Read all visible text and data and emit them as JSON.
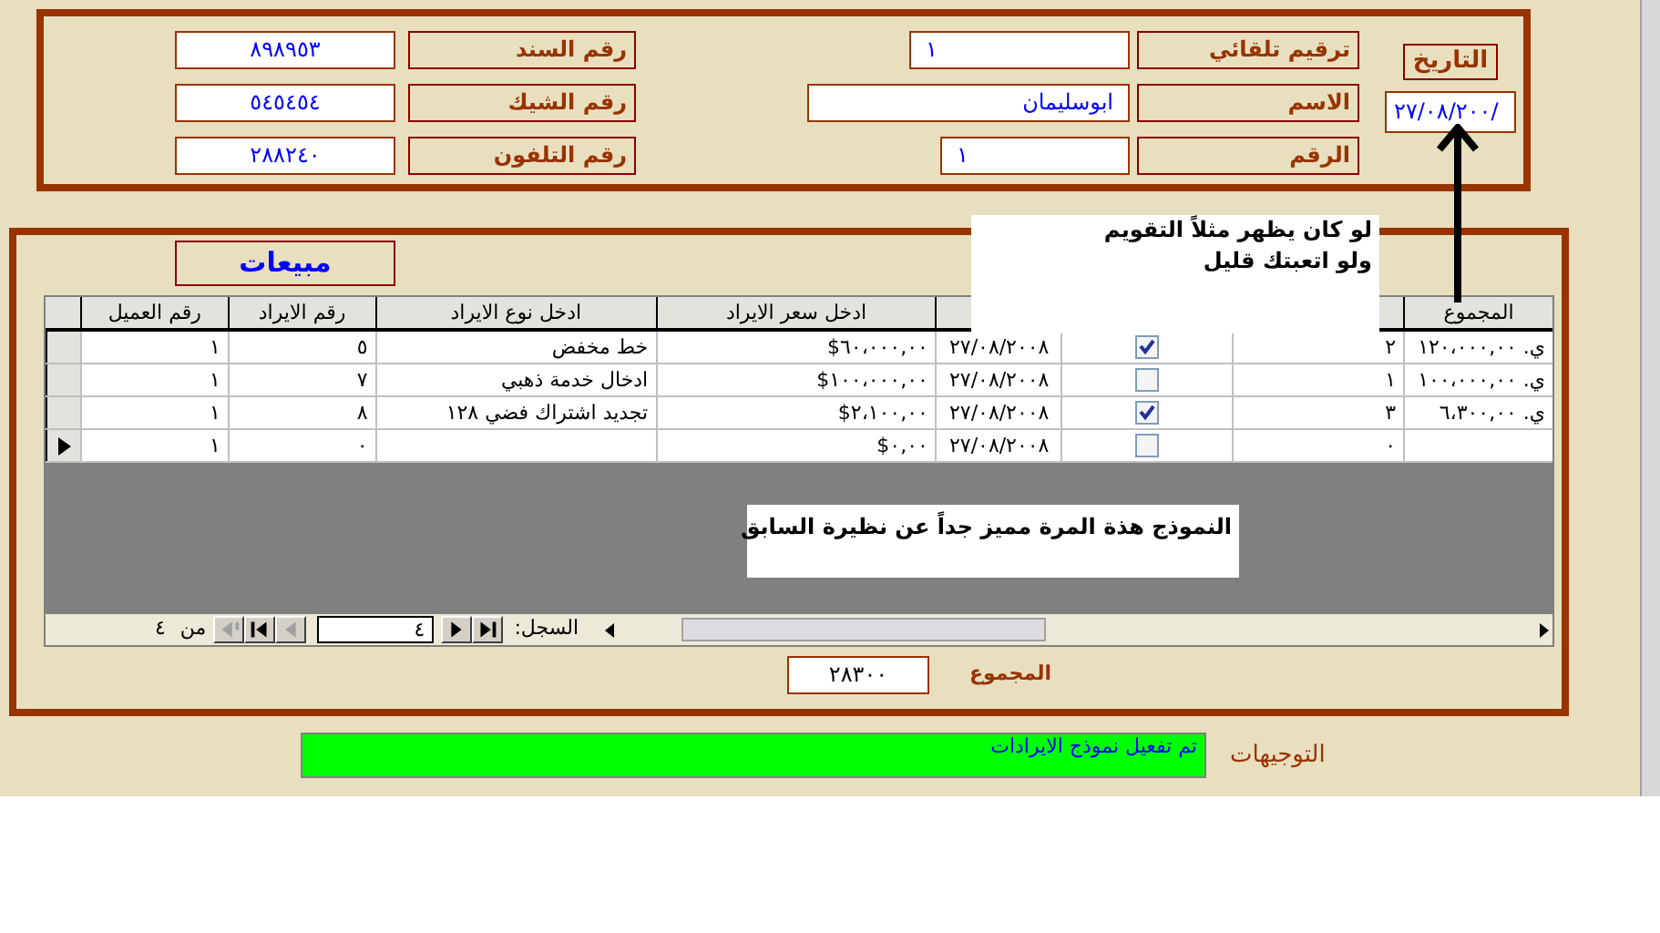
{
  "date": {
    "label": "التاريخ",
    "value": "٢٧/٠٨/٢٠٠/"
  },
  "header_fields": [
    {
      "label": "ترقيم تلقائي",
      "value": "١"
    },
    {
      "label": "الاسم",
      "value": "ابوسليمان"
    },
    {
      "label": "الرقم",
      "value": "١"
    }
  ],
  "voucher_fields": [
    {
      "label": "رقم السند",
      "value": "٨٩٨٩٥٣"
    },
    {
      "label": "رقم الشيك",
      "value": "٥٤٥٤٥٤"
    },
    {
      "label": "رقم التلفون",
      "value": "٢٨٨٢٤٠"
    }
  ],
  "callouts": [
    {
      "lines": [
        "لو كان يظهر مثلاً التقويم",
        "ولو اتعبتك قليل"
      ]
    },
    {
      "lines": [
        "النموذج هذة المرة مميز جداً عن نظيرة السابق"
      ]
    }
  ],
  "subform": {
    "title": "مبيعات",
    "columns": [
      {
        "label": "المجموع"
      },
      {},
      {},
      {},
      {
        "label": "ادخل سعر الايراد"
      },
      {
        "label": "ادخل نوع الايراد"
      },
      {
        "label": "رقم الايراد"
      },
      {
        "label": "رقم العميل"
      }
    ],
    "rows": [
      {
        "total": "ي. ١٢٠،٠٠٠,٠٠",
        "quantity": "٢",
        "checked": true,
        "date": "٢٧/٠٨/٢٠٠٨",
        "price": "$٦٠،٠٠٠,٠٠",
        "type": "خط مخفض",
        "item_no": "٥",
        "customer_no": "١",
        "current": false
      },
      {
        "total": "ي. ١٠٠،٠٠٠,٠٠",
        "quantity": "١",
        "checked": false,
        "date": "٢٧/٠٨/٢٠٠٨",
        "price": "$١٠٠،٠٠٠,٠٠",
        "type": "ادخال خدمة ذهبي",
        "item_no": "٧",
        "customer_no": "١",
        "current": false
      },
      {
        "total": "ي. ٦،٣٠٠,٠٠",
        "quantity": "٣",
        "checked": true,
        "date": "٢٧/٠٨/٢٠٠٨",
        "price": "$٢،١٠٠,٠٠",
        "type": "تجديد اشتراك فضي ١٢٨",
        "item_no": "٨",
        "customer_no": "١",
        "current": false
      },
      {
        "quantity": "٠",
        "checked": false,
        "date": "٢٧/٠٨/٢٠٠٨",
        "price": "$٠,٠٠",
        "item_no": "٠",
        "customer_no": "١",
        "current": true
      }
    ],
    "navigator": {
      "label": "السجل:",
      "current": "٤",
      "of": "من",
      "count": "٤",
      "buttons": [
        {
          "kind": "new",
          "disabled": true
        },
        {
          "kind": "first",
          "disabled": false
        },
        {
          "kind": "prev",
          "disabled": true
        },
        {
          "kind": "next",
          "disabled": false
        },
        {
          "kind": "last",
          "disabled": false
        }
      ]
    }
  },
  "total": {
    "label": "المجموع",
    "value": "٢٨٣٠٠"
  },
  "directives": {
    "label": "التوجيهات",
    "value": "تم تفعيل نموذج الايرادات"
  }
}
